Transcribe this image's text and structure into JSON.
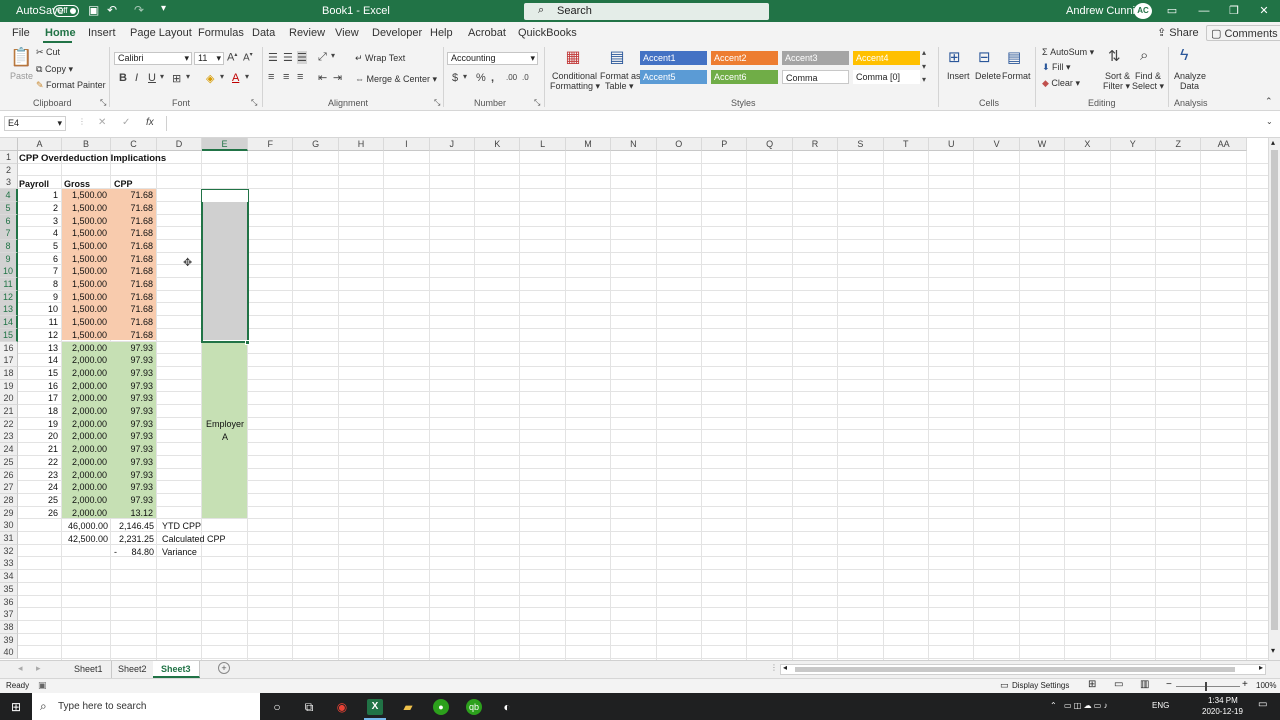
{
  "titlebar": {
    "autosave_label": "AutoSave",
    "autosave_state": "Off",
    "doc_title": "Book1 - Excel",
    "search_placeholder": "Search",
    "user_name": "Andrew Cunning",
    "user_initials": "AC"
  },
  "menu": {
    "tabs": [
      "File",
      "Home",
      "Insert",
      "Page Layout",
      "Formulas",
      "Data",
      "Review",
      "View",
      "Developer",
      "Help",
      "Acrobat",
      "QuickBooks"
    ],
    "active": "Home",
    "share_label": "Share",
    "comments_label": "Comments"
  },
  "ribbon": {
    "clipboard": {
      "paste": "Paste",
      "cut": "Cut",
      "copy": "Copy",
      "format_painter": "Format Painter",
      "group": "Clipboard"
    },
    "font": {
      "name": "Calibri",
      "size": "11",
      "bold": "B",
      "italic": "I",
      "underline": "U",
      "group": "Font"
    },
    "alignment": {
      "wrap_text": "Wrap Text",
      "merge_center": "Merge & Center",
      "group": "Alignment"
    },
    "number": {
      "format": "Accounting",
      "dollar": "$",
      "percent": "%",
      "comma": ",",
      "group": "Number"
    },
    "styles": {
      "conditional_1": "Conditional",
      "conditional_2": "Formatting",
      "format_table_1": "Format as",
      "format_table_2": "Table",
      "chips": [
        "Accent1",
        "Accent2",
        "Accent3",
        "Accent4",
        "Accent5",
        "Accent6",
        "Comma",
        "Comma [0]"
      ],
      "group": "Styles"
    },
    "cells": {
      "insert": "Insert",
      "delete": "Delete",
      "format": "Format",
      "group": "Cells"
    },
    "editing": {
      "autosum": "AutoSum",
      "fill": "Fill",
      "clear": "Clear",
      "sort_1": "Sort &",
      "sort_2": "Filter",
      "find_1": "Find &",
      "find_2": "Select",
      "group": "Editing"
    },
    "analysis": {
      "analyze_1": "Analyze",
      "analyze_2": "Data",
      "group": "Analysis"
    }
  },
  "formula_bar": {
    "name_box": "E4",
    "cancel": "✕",
    "enter": "✓",
    "fx": "fx",
    "content": ""
  },
  "grid": {
    "columns": [
      "A",
      "B",
      "C",
      "D",
      "E",
      "F",
      "G",
      "H",
      "I",
      "J",
      "K",
      "L",
      "M",
      "N",
      "O",
      "P",
      "Q",
      "R",
      "S",
      "T",
      "U",
      "V",
      "W",
      "X",
      "Y",
      "Z",
      "AA"
    ],
    "selected_column": "E",
    "selected_cell": "E4",
    "rows": [
      "1",
      "2",
      "3",
      "4",
      "5",
      "6",
      "7",
      "8",
      "9",
      "10",
      "11",
      "12",
      "13",
      "14",
      "15",
      "16",
      "17",
      "18",
      "19",
      "20",
      "21",
      "22",
      "23",
      "24",
      "25",
      "26",
      "27",
      "28",
      "29",
      "30",
      "31",
      "32",
      "33",
      "34",
      "35",
      "36",
      "37",
      "38",
      "39",
      "40"
    ],
    "title": "CPP Overdeduction Implications",
    "headers": {
      "a": "Payroll",
      "b": "Gross",
      "c": "CPP"
    },
    "payroll": [
      "1",
      "2",
      "3",
      "4",
      "5",
      "6",
      "7",
      "8",
      "9",
      "10",
      "11",
      "12",
      "13",
      "14",
      "15",
      "16",
      "17",
      "18",
      "19",
      "20",
      "21",
      "22",
      "23",
      "24",
      "25",
      "26"
    ],
    "gross": [
      "1,500.00",
      "1,500.00",
      "1,500.00",
      "1,500.00",
      "1,500.00",
      "1,500.00",
      "1,500.00",
      "1,500.00",
      "1,500.00",
      "1,500.00",
      "1,500.00",
      "1,500.00",
      "2,000.00",
      "2,000.00",
      "2,000.00",
      "2,000.00",
      "2,000.00",
      "2,000.00",
      "2,000.00",
      "2,000.00",
      "2,000.00",
      "2,000.00",
      "2,000.00",
      "2,000.00",
      "2,000.00",
      "2,000.00"
    ],
    "cpp": [
      "71.68",
      "71.68",
      "71.68",
      "71.68",
      "71.68",
      "71.68",
      "71.68",
      "71.68",
      "71.68",
      "71.68",
      "71.68",
      "71.68",
      "97.93",
      "97.93",
      "97.93",
      "97.93",
      "97.93",
      "97.93",
      "97.93",
      "97.93",
      "97.93",
      "97.93",
      "97.93",
      "97.93",
      "97.93",
      "13.12"
    ],
    "employer_label_1": "Employer",
    "employer_label_2": "A",
    "totals": {
      "row30": {
        "b": "46,000.00",
        "c": "2,146.45",
        "d": "YTD CPP"
      },
      "row31": {
        "b": "42,500.00",
        "c": "2,231.25",
        "d": "Calculated CPP"
      },
      "row32": {
        "c_dash": "-",
        "c": "84.80",
        "d": "Variance"
      }
    }
  },
  "sheets": {
    "tabs": [
      "Sheet1",
      "Sheet2",
      "Sheet3"
    ],
    "active": "Sheet3",
    "add": "+"
  },
  "status": {
    "ready": "Ready",
    "display_settings": "Display Settings",
    "zoom": "100%"
  },
  "taskbar": {
    "search_placeholder": "Type here to search",
    "lang": "ENG",
    "time": "1:34 PM",
    "date": "2020-12-19"
  },
  "colors": {
    "excel_green": "#217346",
    "orange_fill": "#f8cbad",
    "green_fill": "#c6e0b4",
    "accent1": "#4472c4",
    "accent2": "#ed7d31",
    "accent3": "#a5a5a5",
    "accent4": "#ffc000",
    "accent5": "#5b9bd5",
    "accent6": "#70ad47"
  }
}
